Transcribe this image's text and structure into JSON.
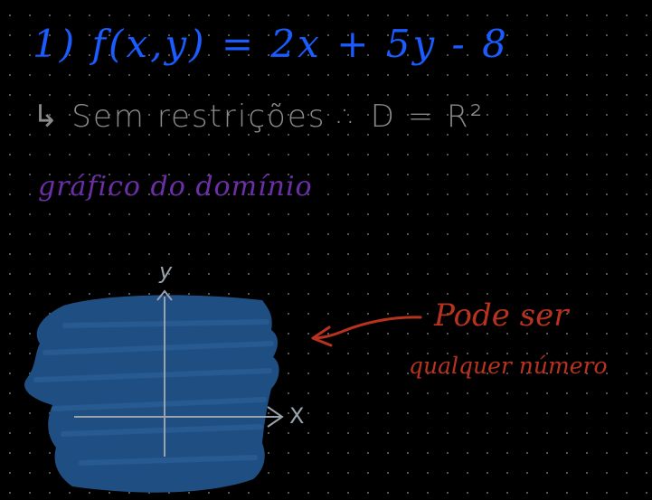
{
  "notes": {
    "line1": "1) f(x,y) = 2x + 5y - 8",
    "line2": "↳ Sem restrições ∴ D = R²",
    "line3": "gráfico do domínio",
    "annotation_line1": "Pode ser",
    "annotation_line2": "qualquer número"
  },
  "graph": {
    "y_label": "y",
    "x_label": "X"
  },
  "colors": {
    "background": "#000000",
    "grid_dots": "#5a5a5a",
    "ink_blue": "#1a5cff",
    "ink_gray": "#8a8a8a",
    "ink_purple": "#6b2fa6",
    "ink_red": "#b8321f",
    "region_fill": "#1f4f82",
    "axes": "#9aa3ad"
  }
}
